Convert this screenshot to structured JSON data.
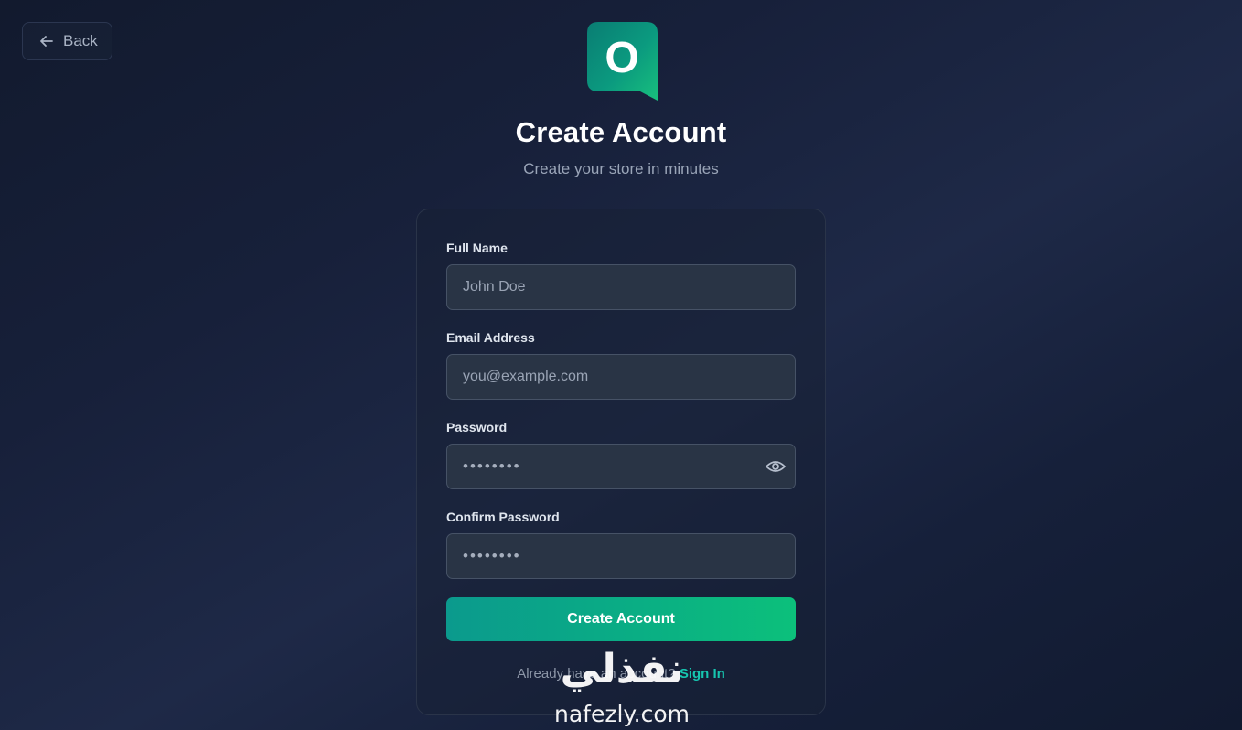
{
  "header": {
    "back_label": "Back",
    "logo_letter": "O",
    "title": "Create Account",
    "subtitle": "Create your store in minutes"
  },
  "form": {
    "full_name": {
      "label": "Full Name",
      "placeholder": "John Doe",
      "value": ""
    },
    "email": {
      "label": "Email Address",
      "placeholder": "you@example.com",
      "value": ""
    },
    "password": {
      "label": "Password",
      "placeholder": "••••••••",
      "value": ""
    },
    "confirm_password": {
      "label": "Confirm Password",
      "placeholder": "••••••••",
      "value": ""
    },
    "submit_label": "Create Account"
  },
  "footer": {
    "prompt": "Already have an account?",
    "link": "Sign In"
  },
  "watermark": {
    "arabic": "نفذلي",
    "latin": "nafezly.com"
  },
  "colors": {
    "accent": "#16c6b0",
    "button_start": "#0b9a8d",
    "button_end": "#0cc07b",
    "background": "#17203a"
  }
}
